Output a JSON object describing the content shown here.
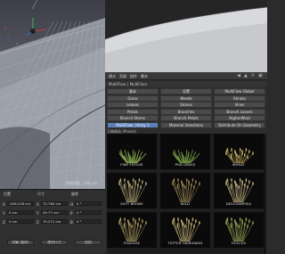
{
  "menubar": {
    "items": [
      "模式",
      "资源",
      "插件",
      "脚本"
    ],
    "icons": [
      "back-icon",
      "forward-icon",
      "refresh-icon",
      "settings-icon"
    ]
  },
  "path": "MultiFloor | MultiFloor",
  "categories": [
    [
      "基本",
      "设置",
      "MultiFlow Global"
    ],
    [
      "Grass",
      "Weeds",
      "Shrubs"
    ],
    [
      "Leaves",
      "Stones",
      "Vines"
    ],
    [
      "Petals",
      "Branches",
      "Branch Leaves"
    ],
    [
      "Branch Stems",
      "Branch Petals",
      "HigherWind"
    ],
    [
      "MultiFlow | Array 1",
      "Material Selections",
      "Distribute On Geometry"
    ]
  ],
  "active_category": "MultiFlow | Array 1",
  "section_label": "万物精选 (Preset)",
  "thumbnails": [
    {
      "name": "FINE FESCUE",
      "icon": "grass-tuft-icon"
    },
    {
      "name": "POA GRASS",
      "icon": "grass-tuft-icon"
    },
    {
      "name": "WHEAT",
      "icon": "wheat-icon"
    },
    {
      "name": "SOFT BROME",
      "icon": "grass-plume-icon"
    },
    {
      "name": "WILD",
      "icon": "grass-plume-icon"
    },
    {
      "name": "DESCHAMPSIA",
      "icon": "grass-plume-icon"
    },
    {
      "name": "POACEAE",
      "icon": "grass-plume-icon"
    },
    {
      "name": "TUFTED HAIRGRASS",
      "icon": "grass-plume-icon"
    },
    {
      "name": "HOLCUS",
      "icon": "grass-plume-icon"
    }
  ],
  "viewport": {
    "scale_text": "网格间距 : 100 cm",
    "accent": "#5d7fb8"
  },
  "coords": {
    "tabs": [
      "位置",
      "尺寸",
      "旋转"
    ],
    "rows": [
      {
        "axis": "X",
        "pos": "-556.228 cm",
        "size": "72.785 cm",
        "rot_axis": "H",
        "rot": "0 °"
      },
      {
        "axis": "Y",
        "pos": "0 cm",
        "size": "49.77 cm",
        "rot_axis": "P",
        "rot": "0 °"
      },
      {
        "axis": "Z",
        "pos": "0 cm",
        "size": "70.271 cm",
        "rot_axis": "B",
        "rot": "0 °"
      }
    ],
    "mode": "对象 (相对)",
    "size_mode": "绝对尺寸",
    "apply_label": "应用"
  }
}
